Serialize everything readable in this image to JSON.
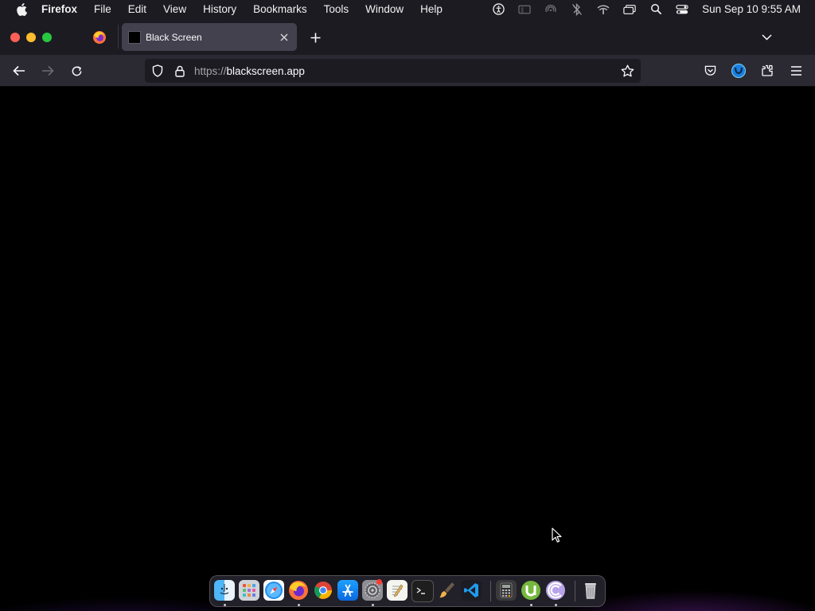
{
  "menubar": {
    "apple_icon": "apple-icon",
    "items": [
      "Firefox",
      "File",
      "Edit",
      "View",
      "History",
      "Bookmarks",
      "Tools",
      "Window",
      "Help"
    ],
    "clock": "Sun Sep 10  9:55 AM",
    "status_icons": [
      "accessibility-icon",
      "screen-mirroring-icon",
      "airdrop-icon",
      "bluetooth-off-icon",
      "wifi-icon",
      "window-icon",
      "spotlight-search-icon",
      "control-center-icon"
    ]
  },
  "tabstrip": {
    "tabs": [
      {
        "title": "Black Screen",
        "active": true
      }
    ],
    "new_tab_icon": "plus-icon",
    "list_all_tabs_icon": "chevron-down-icon"
  },
  "navbar": {
    "url_scheme": "https://",
    "url_host": "blackscreen.app",
    "buttons": [
      "back-icon",
      "forward-icon",
      "reload-icon",
      "pocket-icon",
      "account-icon",
      "extensions-icon",
      "menu-icon"
    ]
  },
  "page": {
    "background": "#000000"
  },
  "dock": {
    "apps": [
      "Finder",
      "Launchpad",
      "Safari",
      "Firefox",
      "Google Chrome",
      "App Store",
      "System Settings",
      "TextEdit",
      "Terminal",
      "Brush",
      "Visual Studio Code",
      "Calculator",
      "uTorrent",
      "Torrent Client",
      "Trash"
    ]
  },
  "colors": {
    "toolbar": "#2b2a33",
    "tabstrip": "#1c1b22",
    "active_tab": "#42414d",
    "urlbar": "#1c1b22",
    "accent": "#0060df"
  }
}
